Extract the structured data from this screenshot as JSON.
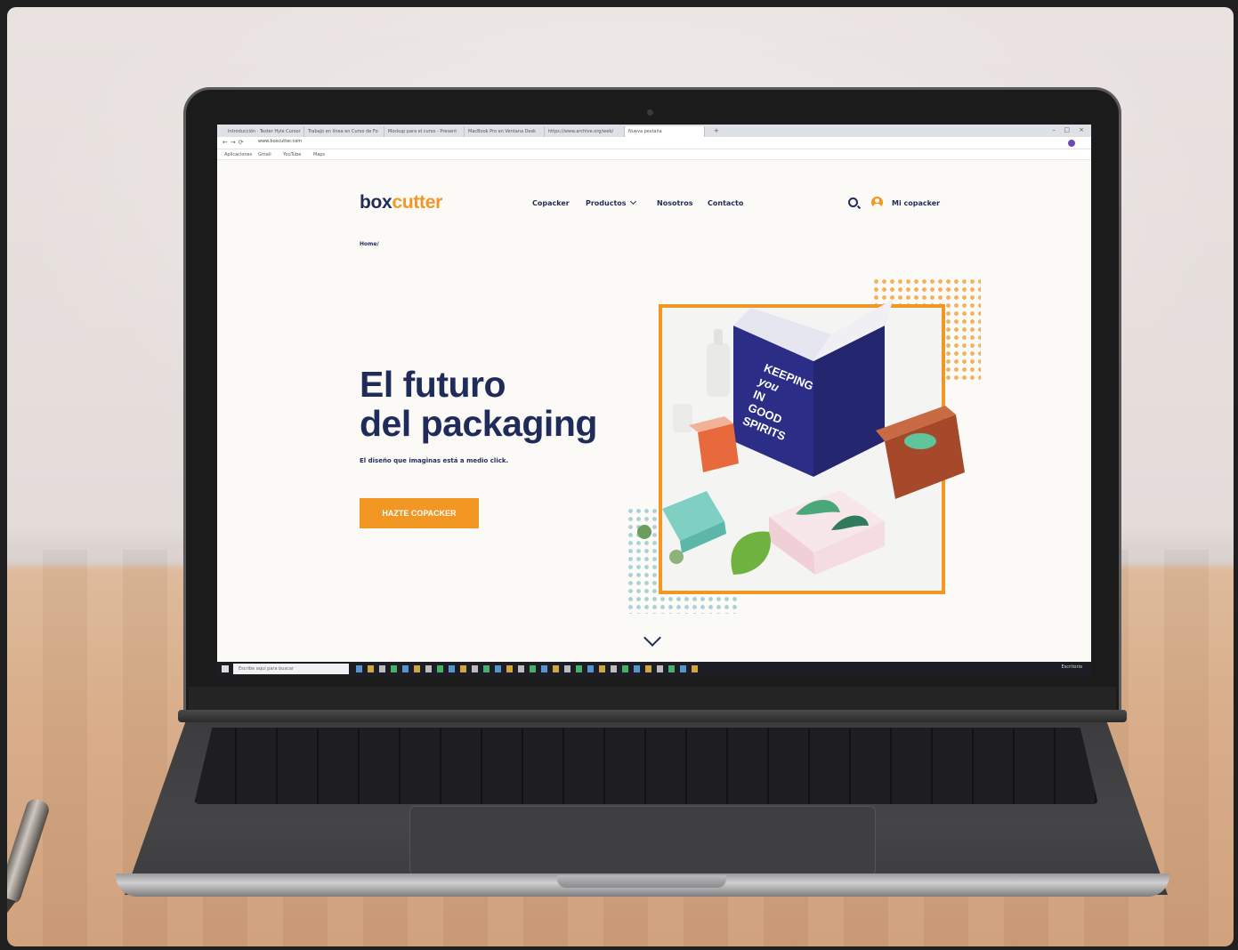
{
  "browser": {
    "tabs": [
      {
        "label": "Introducción · Tester Hyle Cursor"
      },
      {
        "label": "Trabajo en línea en Curso de Fo"
      },
      {
        "label": "Mockup para el curso - Present"
      },
      {
        "label": "MacBook Pro en Ventana Desk"
      },
      {
        "label": "https://www.archive.org/web/"
      },
      {
        "label": "Nueva pestaña"
      }
    ],
    "url": "www.boxcutter.com",
    "bookmarks": [
      "Aplicaciones",
      "Gmail",
      "YouTube",
      "Maps"
    ]
  },
  "site": {
    "logo_left": "box",
    "logo_right": "cutter",
    "nav": {
      "copacker": "Copacker",
      "productos": "Productos",
      "nosotros": "Nosotros",
      "contacto": "Contacto"
    },
    "account_label": "Mi copacker",
    "breadcrumb": "Home/",
    "hero": {
      "title_line1": "El futuro",
      "title_line2": "del packaging",
      "subtitle": "El diseño que imaginas está a medio click.",
      "cta": "HAZTE COPACKER"
    },
    "box_print": {
      "line1": "KEEPING",
      "line2": "you",
      "line3": "IN",
      "line4": "GOOD",
      "line5": "SPIRITS"
    },
    "colors": {
      "navy": "#1f2c5a",
      "orange": "#f29724",
      "teal": "#a9d3d6"
    }
  },
  "taskbar": {
    "search_placeholder": "Escribe aquí para buscar",
    "tray_text": "Escritorio"
  }
}
